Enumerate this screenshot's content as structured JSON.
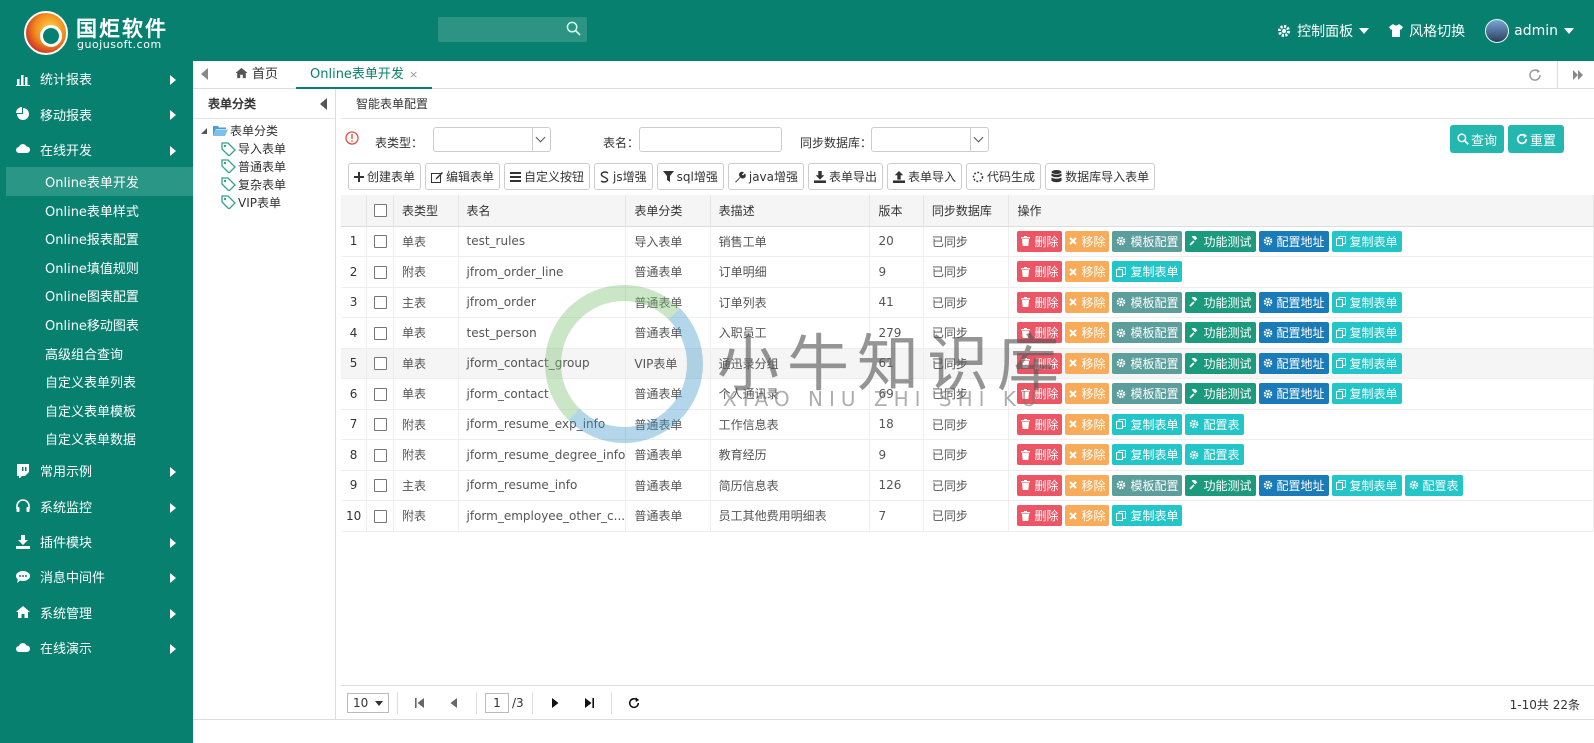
{
  "brand": {
    "name": "国炬软件",
    "sub": "guojusoft.com"
  },
  "header": {
    "search_placeholder": "",
    "control_panel": "控制面板",
    "style_switch": "风格切换",
    "user": "admin"
  },
  "sidebar": {
    "items": [
      {
        "label": "统计报表",
        "icon": "bar-chart-icon"
      },
      {
        "label": "移动报表",
        "icon": "pie-chart-icon"
      },
      {
        "label": "在线开发",
        "icon": "cloud-icon"
      }
    ],
    "sub_items": [
      "Online表单开发",
      "Online表单样式",
      "Online报表配置",
      "Online填值规则",
      "Online图表配置",
      "Online移动图表",
      "高级组合查询",
      "自定义表单列表",
      "自定义表单模板",
      "自定义表单数据"
    ],
    "items2": [
      {
        "label": "常用示例",
        "icon": "twitch-icon"
      },
      {
        "label": "系统监控",
        "icon": "headphones-icon"
      },
      {
        "label": "插件模块",
        "icon": "download-icon"
      },
      {
        "label": "消息中间件",
        "icon": "comment-icon"
      },
      {
        "label": "系统管理",
        "icon": "home-icon"
      },
      {
        "label": "在线演示",
        "icon": "cloud-icon"
      }
    ]
  },
  "tabs": {
    "home": "首页",
    "active": "Online表单开发",
    "close": "×"
  },
  "left_pane": {
    "title": "表单分类",
    "root": "表单分类",
    "children": [
      "导入表单",
      "普通表单",
      "复杂表单",
      "VIP表单"
    ]
  },
  "main": {
    "title": "智能表单配置",
    "filter": {
      "type_label": "表类型：",
      "name_label": "表名：",
      "sync_label": "同步数据库：",
      "query": "查询",
      "reset": "重置"
    },
    "toolbar": [
      "创建表单",
      "编辑表单",
      "自定义按钮",
      "js增强",
      "sql增强",
      "java增强",
      "表单导出",
      "表单导入",
      "代码生成",
      "数据库导入表单"
    ],
    "columns": [
      "表类型",
      "表名",
      "表单分类",
      "表描述",
      "版本",
      "同步数据库",
      "操作"
    ],
    "rows": [
      {
        "n": "1",
        "type": "单表",
        "name": "test_rules",
        "cat": "导入表单",
        "desc": "销售工单",
        "ver": "20",
        "sync": "已同步",
        "actions": [
          "删除",
          "移除",
          "模板配置",
          "功能测试",
          "配置地址",
          "复制表单"
        ]
      },
      {
        "n": "2",
        "type": "附表",
        "name": "jfrom_order_line",
        "cat": "普通表单",
        "desc": "订单明细",
        "ver": "9",
        "sync": "已同步",
        "actions": [
          "删除",
          "移除",
          "复制表单"
        ]
      },
      {
        "n": "3",
        "type": "主表",
        "name": "jfrom_order",
        "cat": "普通表单",
        "desc": "订单列表",
        "ver": "41",
        "sync": "已同步",
        "actions": [
          "删除",
          "移除",
          "模板配置",
          "功能测试",
          "配置地址",
          "复制表单"
        ]
      },
      {
        "n": "4",
        "type": "单表",
        "name": "test_person",
        "cat": "普通表单",
        "desc": "入职员工",
        "ver": "279",
        "sync": "已同步",
        "actions": [
          "删除",
          "移除",
          "模板配置",
          "功能测试",
          "配置地址",
          "复制表单"
        ]
      },
      {
        "n": "5",
        "type": "单表",
        "name": "jform_contact_group",
        "cat": "VIP表单",
        "desc": "通迅录分组",
        "ver": "61",
        "sync": "已同步",
        "actions": [
          "删除",
          "移除",
          "模板配置",
          "功能测试",
          "配置地址",
          "复制表单"
        ]
      },
      {
        "n": "6",
        "type": "单表",
        "name": "jform_contact",
        "cat": "普通表单",
        "desc": "个人通讯录",
        "ver": "69",
        "sync": "已同步",
        "actions": [
          "删除",
          "移除",
          "模板配置",
          "功能测试",
          "配置地址",
          "复制表单"
        ]
      },
      {
        "n": "7",
        "type": "附表",
        "name": "jform_resume_exp_info",
        "cat": "普通表单",
        "desc": "工作信息表",
        "ver": "18",
        "sync": "已同步",
        "actions": [
          "删除",
          "移除",
          "复制表单",
          "配置表"
        ]
      },
      {
        "n": "8",
        "type": "附表",
        "name": "jform_resume_degree_info",
        "cat": "普通表单",
        "desc": "教育经历",
        "ver": "9",
        "sync": "已同步",
        "actions": [
          "删除",
          "移除",
          "复制表单",
          "配置表"
        ]
      },
      {
        "n": "9",
        "type": "主表",
        "name": "jform_resume_info",
        "cat": "普通表单",
        "desc": "简历信息表",
        "ver": "126",
        "sync": "已同步",
        "actions": [
          "删除",
          "移除",
          "模板配置",
          "功能测试",
          "配置地址",
          "复制表单",
          "配置表"
        ]
      },
      {
        "n": "10",
        "type": "附表",
        "name": "jform_employee_other_c...",
        "cat": "普通表单",
        "desc": "员工其他费用明细表",
        "ver": "7",
        "sync": "已同步",
        "actions": [
          "删除",
          "移除",
          "复制表单"
        ]
      }
    ],
    "pager": {
      "size": "10",
      "page": "1",
      "total_pages": "/3",
      "info": "1-10共 22条"
    }
  },
  "watermark": {
    "text": "小牛知识库",
    "sub": "XIAO NIU ZHI SHI KU"
  },
  "colors": {
    "primary": "#07806f",
    "delete": "#ed5565",
    "move": "#f8ac59",
    "template": "#5c9e9c",
    "test": "#1c9a7e",
    "address": "#1a7bb9",
    "copy": "#23c6c8"
  }
}
